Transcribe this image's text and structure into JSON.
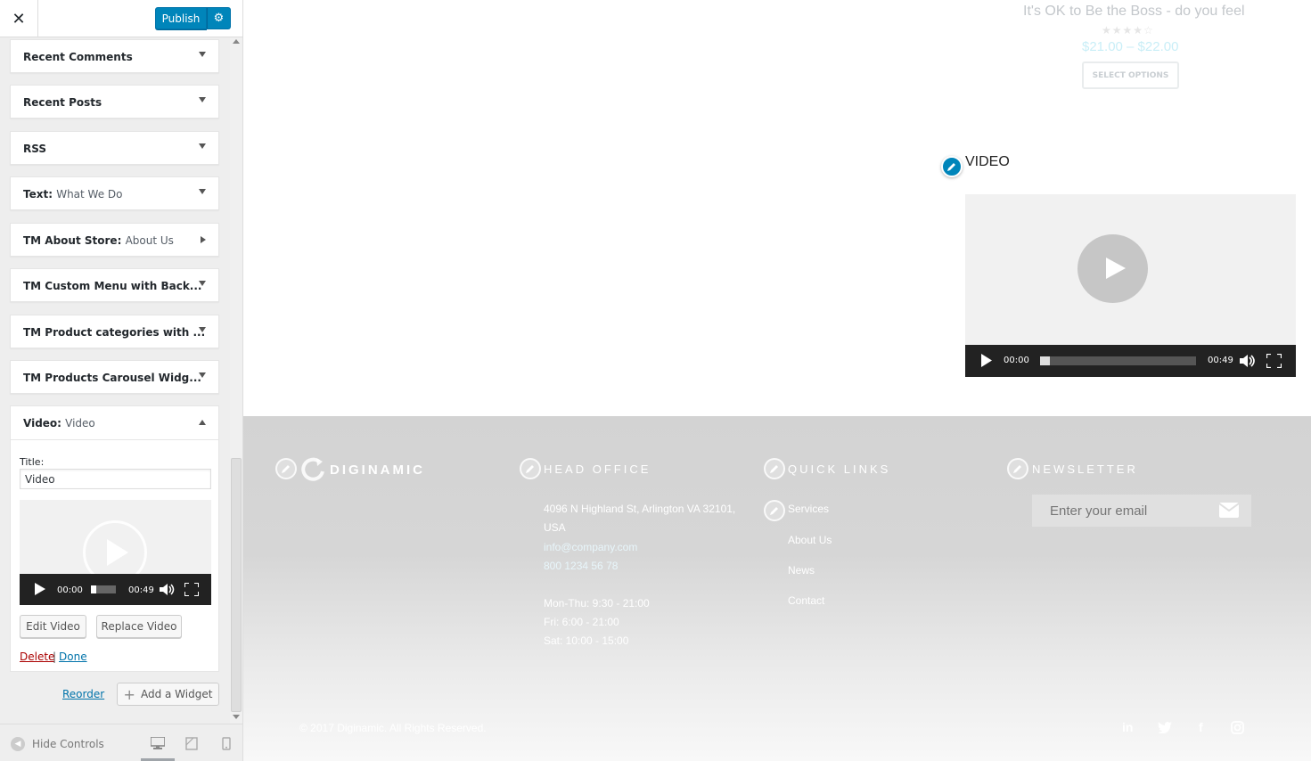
{
  "header": {
    "close_glyph": "✕",
    "publish_label": "Publish",
    "settings_glyph": "⚙"
  },
  "widgets": [
    {
      "name": "Recent Comments",
      "instance": "",
      "state": "collapsed"
    },
    {
      "name": "Recent Posts",
      "instance": "",
      "state": "collapsed"
    },
    {
      "name": "RSS",
      "instance": "",
      "state": "collapsed"
    },
    {
      "name": "Text:",
      "instance": "What We Do",
      "state": "collapsed"
    },
    {
      "name": "TM About Store:",
      "instance": "About Us",
      "state": "right"
    },
    {
      "name": "TM Custom Menu with Back...",
      "instance": "",
      "state": "collapsed"
    },
    {
      "name": "TM Product categories with ...",
      "instance": "",
      "state": "collapsed"
    },
    {
      "name": "TM Products Carousel Widg...",
      "instance": "",
      "state": "collapsed"
    }
  ],
  "video_widget": {
    "name": "Video:",
    "instance": "Video",
    "title_label": "Title:",
    "title_value": "Video",
    "time_current": "00:00",
    "time_total": "00:49",
    "edit_label": "Edit Video",
    "replace_label": "Replace Video",
    "delete_label": "Delete",
    "separator": "|",
    "done_label": "Done"
  },
  "actions": {
    "reorder_label": "Reorder",
    "add_widget_label": "Add a Widget",
    "add_glyph": "+"
  },
  "footer_controls": {
    "hide_label": "Hide Controls",
    "hide_glyph": "◀"
  },
  "preview": {
    "product_title": "It's OK to Be the Boss -  do you feel",
    "product_stars": "★★★★☆",
    "product_price": "$21.00 – $22.00",
    "select_options": "SELECT OPTIONS",
    "video_heading": "VIDEO",
    "video_time_current": "00:00",
    "video_time_total": "00:49",
    "footer": {
      "logo_text": "DIGINAMIC",
      "head_office_heading": "HEAD OFFICE",
      "address_line1": "4096 N Highland St, Arlington VA 32101,",
      "address_line2": "USA",
      "email": "info@company.com",
      "phone": "800 1234 56 78",
      "hours_1": "Mon-Thu: 9:30 - 21:00",
      "hours_2": "Fri: 6:00 - 21:00",
      "hours_3": "Sat: 10:00 - 15:00",
      "quick_links_heading": "QUICK LINKS",
      "quick_links": [
        "Services",
        "About Us",
        "News",
        "Contact"
      ],
      "newsletter_heading": "NEWSLETTER",
      "newsletter_placeholder": "Enter your email",
      "copyright": "© 2017 Diginamic. All Rights Reserved.",
      "social": [
        "in",
        "",
        "f",
        ""
      ]
    }
  },
  "colors": {
    "publish_blue": "#0085ba",
    "delete_red": "#a00",
    "link_blue": "#0073aa"
  }
}
